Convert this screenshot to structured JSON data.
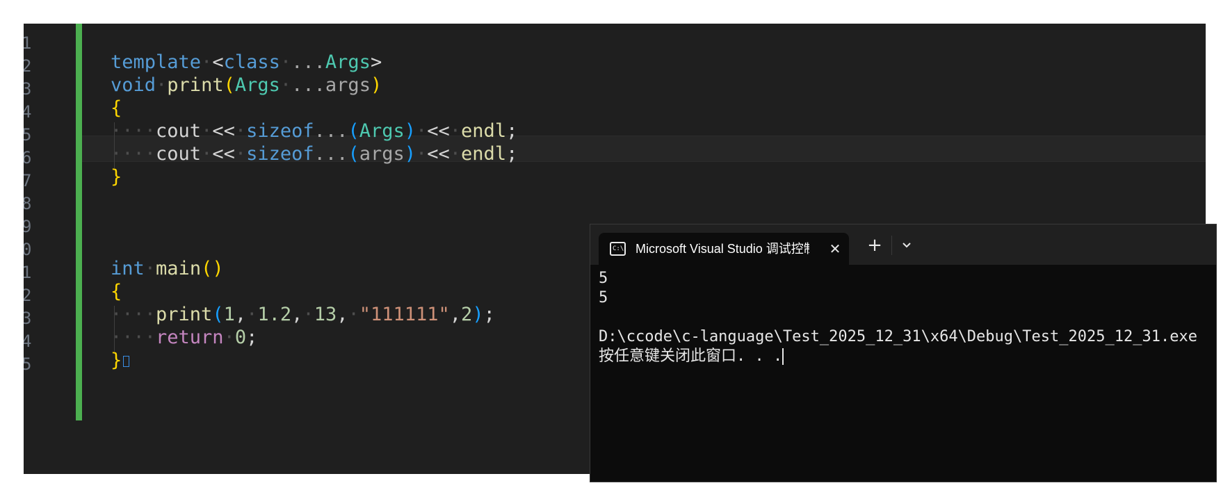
{
  "editor": {
    "gutter": [
      "1",
      "2",
      "3",
      "4",
      "5",
      "6",
      "7",
      "8",
      "9",
      "0",
      "1",
      "2",
      "3",
      "4",
      "5"
    ],
    "code": {
      "l2_template": "template",
      "l2_class": "class",
      "l2_dots": "...",
      "l2_args": "Args",
      "l3_void": "void",
      "l3_print": "print",
      "l3_Args": "Args",
      "l3_dots": "...",
      "l3_args": "args",
      "l5_cout": "cout",
      "l5_op1": "<<",
      "l5_sizeof": "sizeof",
      "l5_dots": "...",
      "l5_Args": "Args",
      "l5_op2": "<<",
      "l5_endl": "endl",
      "l6_cout": "cout",
      "l6_op1": "<<",
      "l6_sizeof": "sizeof",
      "l6_dots": "...",
      "l6_args": "args",
      "l6_op2": "<<",
      "l6_endl": "endl",
      "l11_int": "int",
      "l11_main": "main",
      "l13_print": "print",
      "l13_n1": "1",
      "l13_n2": "1.2",
      "l13_n3": "13",
      "l13_str": "\"111111\"",
      "l13_n4": "2",
      "l14_return": "return",
      "l14_zero": "0"
    }
  },
  "console": {
    "tab_title": "Microsoft Visual Studio 调试控制台",
    "tab_icon_text": "C:\\",
    "new_tab_label": "+",
    "output": [
      "5",
      "5",
      "",
      "D:\\ccode\\c-language\\Test_2025_12_31\\x64\\Debug\\Test_2025_12_31.exe",
      "按任意键关闭此窗口. . ."
    ]
  },
  "colors": {
    "change_bar": "#4caf50",
    "keyword": "#569cd6",
    "type": "#4ec9b0",
    "function": "#dcdcaa",
    "bracket_gold": "#ffd700",
    "bracket_blue": "#179fff",
    "number": "#b5cea8",
    "string": "#ce9178",
    "control": "#c586c0"
  },
  "icons": {
    "terminal": "terminal-icon",
    "close": "close-icon",
    "add": "plus-icon",
    "dropdown": "chevron-down-icon"
  }
}
